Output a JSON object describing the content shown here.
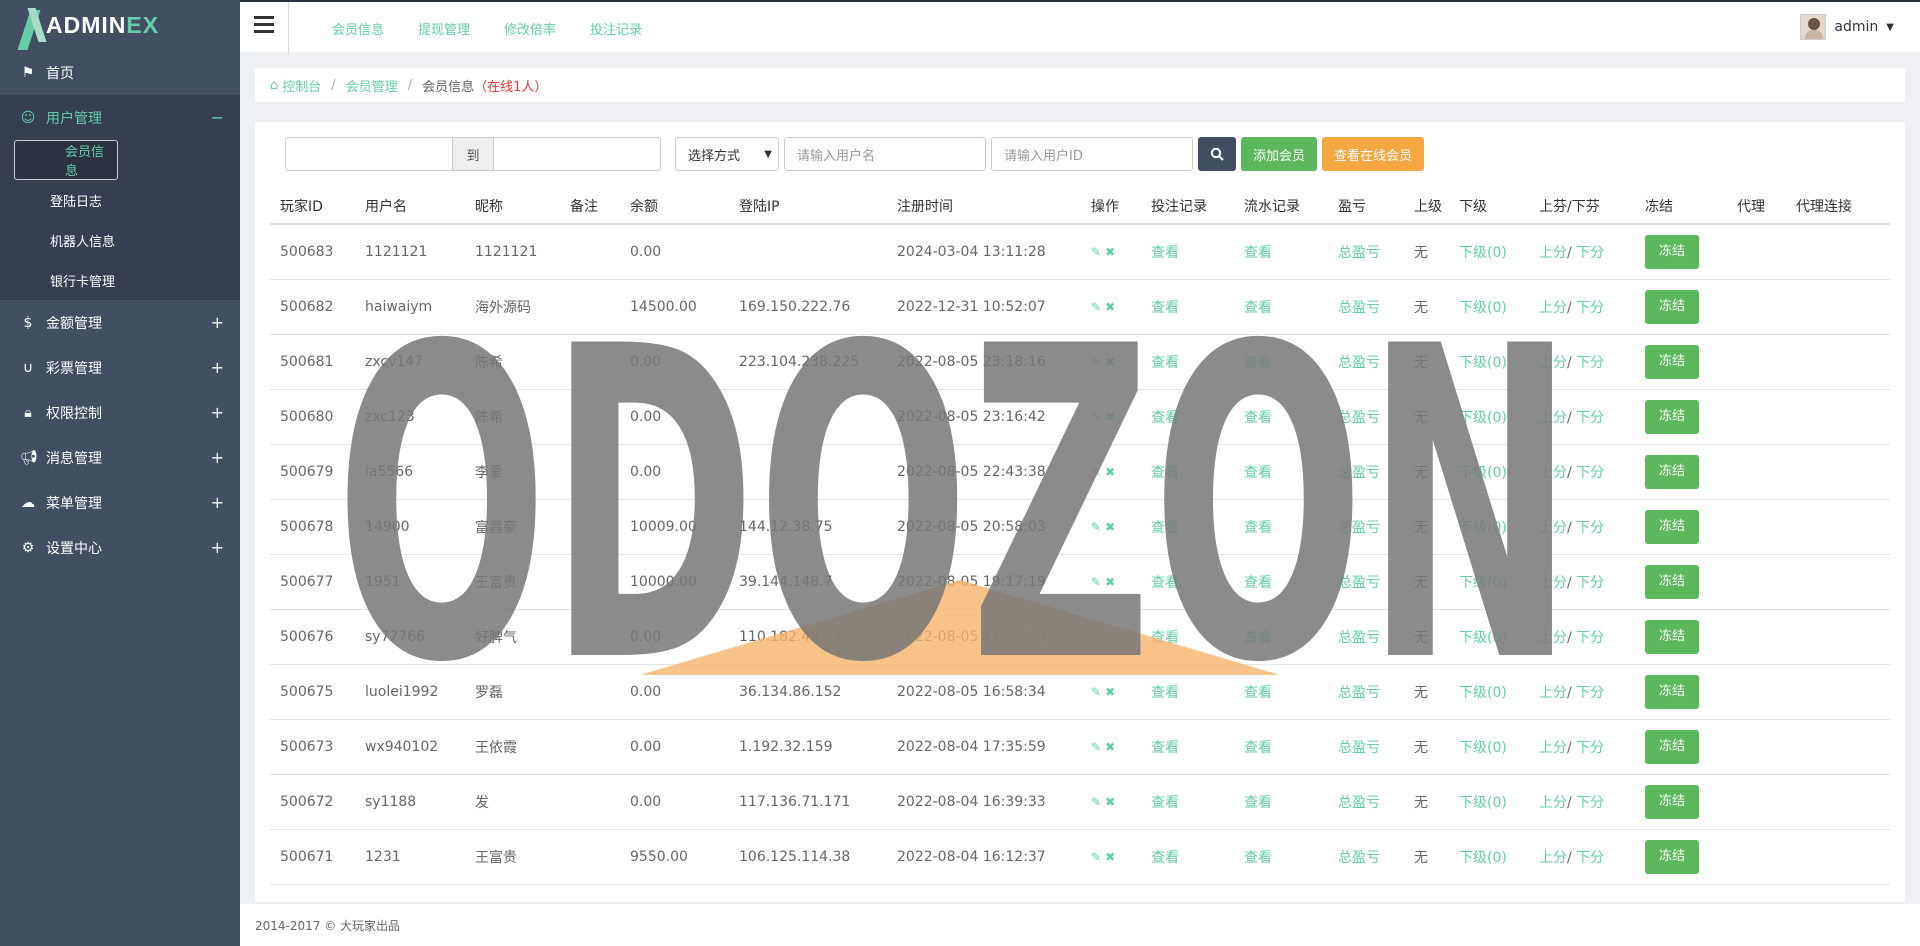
{
  "logo": {
    "text_main": "ADMIN",
    "text_accent": "EX"
  },
  "sidebar": {
    "items": [
      {
        "label": "首页",
        "icon": "flag-icon",
        "toggle": ""
      },
      {
        "label": "用户管理",
        "icon": "smile-icon",
        "toggle": "−"
      },
      {
        "label": "金额管理",
        "icon": "dollar-icon",
        "toggle": "+"
      },
      {
        "label": "彩票管理",
        "icon": "magnet-icon",
        "toggle": "+"
      },
      {
        "label": "权限控制",
        "icon": "lock-icon",
        "toggle": "+"
      },
      {
        "label": "消息管理",
        "icon": "bullhorn-icon",
        "toggle": "+"
      },
      {
        "label": "菜单管理",
        "icon": "cloud-icon",
        "toggle": "+"
      },
      {
        "label": "设置中心",
        "icon": "gear-icon",
        "toggle": "+"
      }
    ],
    "sub_items": [
      {
        "label": "会员信息"
      },
      {
        "label": "登陆日志"
      },
      {
        "label": "机器人信息"
      },
      {
        "label": "银行卡管理"
      }
    ]
  },
  "topnav": {
    "links": [
      "会员信息",
      "提现管理",
      "修改倍率",
      "投注记录"
    ]
  },
  "user": {
    "name": "admin"
  },
  "breadcrumb": {
    "home": "控制台",
    "section": "会员管理",
    "current": "会员信息",
    "online": "（在线1人）"
  },
  "filters": {
    "to_label": "到",
    "select_label": "选择方式",
    "username_placeholder": "请输入用户名",
    "userid_placeholder": "请输入用户ID",
    "add_label": "添加会员",
    "online_label": "查看在线会员"
  },
  "table": {
    "headers": [
      "玩家ID",
      "用户名",
      "昵称",
      "备注",
      "余额",
      "登陆IP",
      "注册时间",
      "操作",
      "投注记录",
      "流水记录",
      "盈亏",
      "上级",
      "下级",
      "上芬/下芬",
      "冻结",
      "代理",
      "代理连接"
    ],
    "link_texts": {
      "view": "查看",
      "profit": "总盈亏",
      "sub": "下级(0)",
      "up": "上分",
      "down": "下分",
      "slash": "/",
      "freeze": "冻结"
    },
    "rows": [
      {
        "id": "500683",
        "user": "1121121",
        "nick": "1121121",
        "note": "",
        "balance": "0.00",
        "ip": "",
        "time": "2024-03-04 13:11:28",
        "parent": "无"
      },
      {
        "id": "500682",
        "user": "haiwaiym",
        "nick": "海外源码",
        "note": "",
        "balance": "14500.00",
        "ip": "169.150.222.76",
        "time": "2022-12-31 10:52:07",
        "parent": "无"
      },
      {
        "id": "500681",
        "user": "zxcv147",
        "nick": "陈希",
        "note": "",
        "balance": "0.00",
        "ip": "223.104.238.225",
        "time": "2022-08-05 23:18:16",
        "parent": "无"
      },
      {
        "id": "500680",
        "user": "zxc123",
        "nick": "陈希",
        "note": "",
        "balance": "0.00",
        "ip": "",
        "time": "2022-08-05 23:16:42",
        "parent": "无"
      },
      {
        "id": "500679",
        "user": "la5566",
        "nick": "李爱",
        "note": "",
        "balance": "0.00",
        "ip": "",
        "time": "2022-08-05 22:43:38",
        "parent": "无"
      },
      {
        "id": "500678",
        "user": "14900",
        "nick": "富昌豪",
        "note": "",
        "balance": "10009.00",
        "ip": "144.12.38.75",
        "time": "2022-08-05 20:58:03",
        "parent": "无"
      },
      {
        "id": "500677",
        "user": "1951",
        "nick": "王富贵",
        "note": "",
        "balance": "10000.00",
        "ip": "39.144.148.7",
        "time": "2022-08-05 19:17:19",
        "parent": "无"
      },
      {
        "id": "500676",
        "user": "sy77766",
        "nick": "好脾气",
        "note": "",
        "balance": "0.00",
        "ip": "110.182.49.232",
        "time": "2022-08-05 17:11:33",
        "parent": "无"
      },
      {
        "id": "500675",
        "user": "luolei1992",
        "nick": "罗磊",
        "note": "",
        "balance": "0.00",
        "ip": "36.134.86.152",
        "time": "2022-08-05 16:58:34",
        "parent": "无"
      },
      {
        "id": "500673",
        "user": "wx940102",
        "nick": "王依霞",
        "note": "",
        "balance": "0.00",
        "ip": "1.192.32.159",
        "time": "2022-08-04 17:35:59",
        "parent": "无"
      },
      {
        "id": "500672",
        "user": "sy1188",
        "nick": "发",
        "note": "",
        "balance": "0.00",
        "ip": "117.136.71.171",
        "time": "2022-08-04 16:39:33",
        "parent": "无"
      },
      {
        "id": "500671",
        "user": "1231",
        "nick": "王富贵",
        "note": "",
        "balance": "9550.00",
        "ip": "106.125.114.38",
        "time": "2022-08-04 16:12:37",
        "parent": "无"
      }
    ]
  },
  "footer": {
    "text": "2014-2017 © 大玩家出品"
  },
  "watermark": {
    "text": "ODOZON",
    "color": "#777777",
    "accent": "#f6b46a"
  },
  "colors": {
    "accent": "#65cea7",
    "sidebar": "#424f63",
    "green": "#5cb85c",
    "orange": "#f5a742"
  }
}
